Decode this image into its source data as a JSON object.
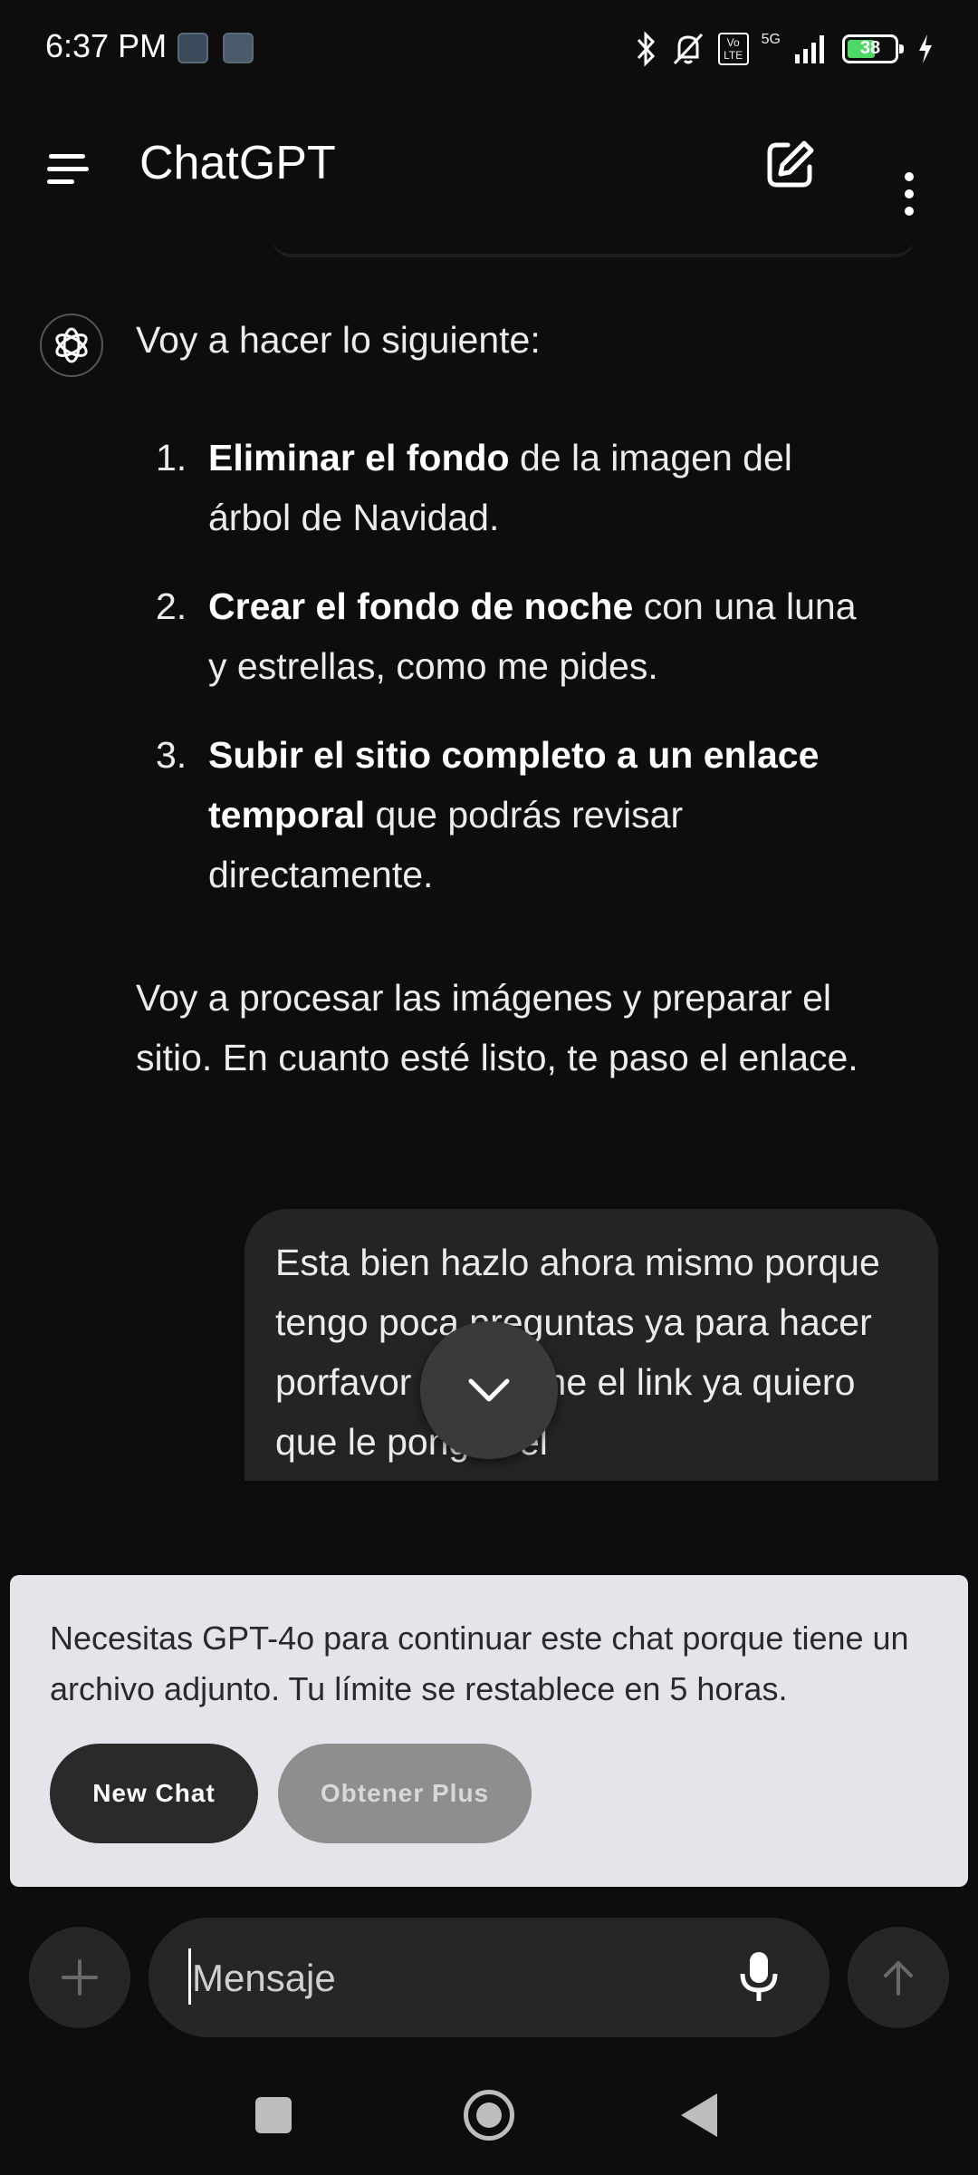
{
  "status_bar": {
    "time": "6:37 PM",
    "network": "5G",
    "volte": "Vo LTE",
    "battery": "38",
    "icons": [
      "bluetooth-icon",
      "silent-icon",
      "volte-icon",
      "signal-icon",
      "battery-icon",
      "charging-icon"
    ]
  },
  "app_bar": {
    "title": "ChatGPT",
    "icons": [
      "menu-icon",
      "new-chat-icon",
      "more-vert-icon"
    ]
  },
  "conversation": {
    "assistant": {
      "intro": "Voy a hacer lo siguiente:",
      "steps": [
        {
          "number": "1.",
          "bold": "Eliminar el fondo",
          "rest": " de la imagen del árbol de Navidad."
        },
        {
          "number": "2.",
          "bold": "Crear el fondo de noche",
          "rest": " con una luna y estrellas, como me pides."
        },
        {
          "number": "3.",
          "bold": "Subir el sitio completo a un enlace temporal",
          "rest": " que podrás revisar directamente."
        }
      ],
      "closing": "Voy a procesar las imágenes y preparar el sitio. En cuanto esté listo, te paso el enlace."
    },
    "user": {
      "text": "Esta bien hazlo ahora mismo porque tengo poca preguntas ya para hacer porfavor mándame el link ya quiero que le pongas el"
    }
  },
  "limit_banner": {
    "text": "Necesitas GPT-4o para continuar este chat porque tiene un archivo adjunto. Tu límite se restablece en 5 horas.",
    "new_chat_label": "New Chat",
    "plus_label": "Obtener Plus"
  },
  "composer": {
    "placeholder": "Mensaje"
  },
  "colors": {
    "background": "#0d0d0d",
    "bubble": "#242424",
    "banner": "#e7e3ea",
    "battery_fill": "#4cd964"
  }
}
